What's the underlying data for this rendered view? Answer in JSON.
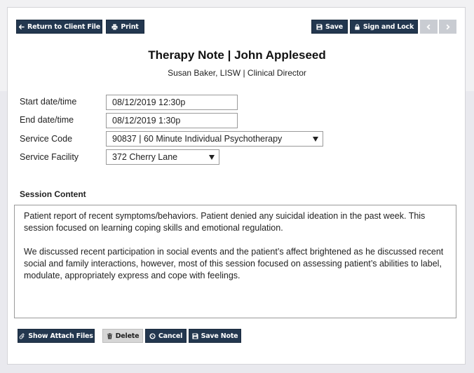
{
  "toolbar": {
    "return_label": "Return to Client File",
    "print_label": "Print",
    "save_label": "Save",
    "sign_lock_label": "Sign and Lock"
  },
  "header": {
    "title": "Therapy Note | John Appleseed",
    "subtitle": "Susan Baker, LISW | Clinical Director"
  },
  "form": {
    "start": {
      "label": "Start date/time",
      "value": "08/12/2019 12:30p"
    },
    "end": {
      "label": "End date/time",
      "value": "08/12/2019 1:30p"
    },
    "service_code": {
      "label": "Service Code",
      "value": "90837 | 60 Minute Individual Psychotherapy"
    },
    "service_facility": {
      "label": "Service Facility",
      "value": "372 Cherry Lane"
    }
  },
  "session": {
    "label": "Session Content",
    "paragraphs": [
      "Patient report of recent symptoms/behaviors. Patient denied any suicidal ideation in the past week. This session focused on learning coping skills and emotional regulation.",
      "We discussed recent participation in social events and the patient’s affect brightened as he discussed recent social and family interactions, however, most of this session focused on assessing patient’s abilities to label, modulate, appropriately express and cope with feelings."
    ]
  },
  "footer": {
    "attach_label": "Show Attach Files",
    "delete_label": "Delete",
    "cancel_label": "Cancel",
    "save_note_label": "Save Note"
  },
  "icons": {
    "return": "arrow-left-icon",
    "print": "printer-icon",
    "save": "floppy-disk-icon",
    "lock": "lock-icon",
    "prev": "chevron-left-icon",
    "next": "chevron-right-icon",
    "attach": "paperclip-icon",
    "delete": "trash-icon",
    "cancel": "ban-icon"
  },
  "colors": {
    "button_primary": "#23374f",
    "button_gray": "#d6d6d6",
    "button_disabled": "#c9ccd2"
  }
}
